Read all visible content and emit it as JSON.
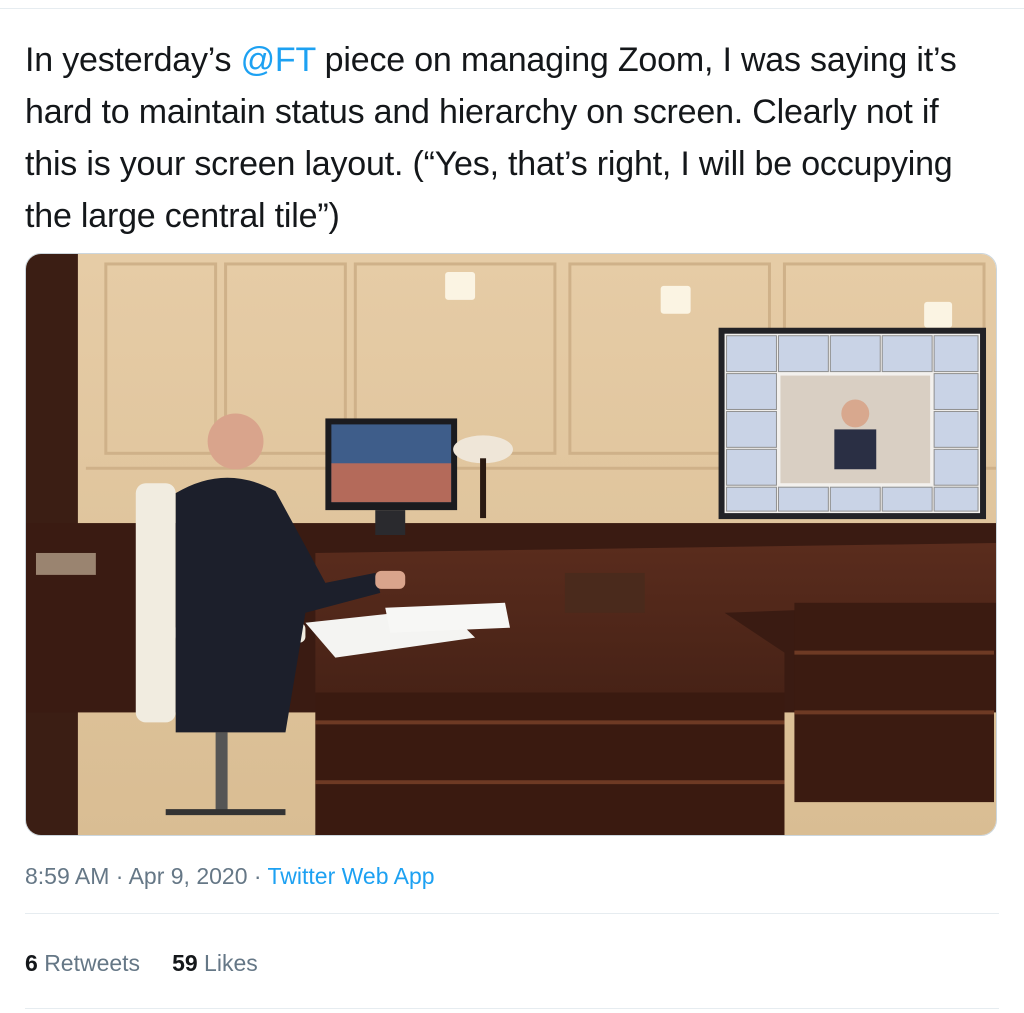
{
  "tweet": {
    "text_before_mention": "In yesterday’s ",
    "mention": "@FT",
    "text_after_mention": " piece on managing Zoom, I was saying it’s hard to maintain status and hierarchy on screen. Clearly not if this is your screen layout. (“Yes, that’s right, I will be occupying the large central tile”)"
  },
  "media": {
    "kind": "photo",
    "colors": {
      "wall": "#e2c9a2",
      "desk": "#4a2418",
      "screen_bg": "#f3f1ee"
    }
  },
  "meta": {
    "time": "8:59 AM",
    "separator": " · ",
    "date": "Apr 9, 2020",
    "source": "Twitter Web App"
  },
  "stats": {
    "retweets_count": "6",
    "retweets_label": "Retweets",
    "likes_count": "59",
    "likes_label": "Likes"
  },
  "colors": {
    "link": "#1da1f2",
    "secondary_text": "#657786",
    "divider": "#e6ecf0"
  }
}
